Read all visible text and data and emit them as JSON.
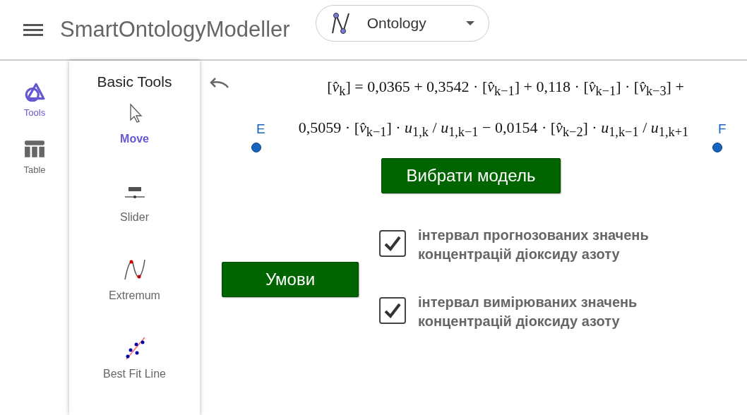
{
  "header": {
    "title": "SmartOntologyModeller",
    "app_selector": {
      "label": "Ontology"
    }
  },
  "rail": [
    {
      "kind": "tools",
      "label": "Tools",
      "selected": true
    },
    {
      "kind": "table",
      "label": "Table",
      "selected": false
    }
  ],
  "tool_panel": {
    "title": "Basic Tools",
    "tools": [
      {
        "kind": "move",
        "label": "Move",
        "selected": true
      },
      {
        "kind": "slider",
        "label": "Slider",
        "selected": false
      },
      {
        "kind": "extremum",
        "label": "Extremum",
        "selected": false
      },
      {
        "kind": "fitline",
        "label": "Best Fit Line",
        "selected": false
      }
    ]
  },
  "canvas": {
    "formula_lines": [
      "[*v̂*$_{k}$] = 0,0365 + 0,3542 · [*v̂*$_{k−1}$] + 0,118 · [*v̂*$_{k−1}$] · [*v̂*$_{k−3}$] +",
      "0,5059 · [*v̂*$_{k−1}$] · *u*$_{1,k}$ / *u*$_{1,k−1}$ − 0,0154 · [*v̂*$_{k−2}$] · *u*$_{1,k−1}$ / *u*$_{1,k+1}$"
    ],
    "points": [
      {
        "label": "E"
      },
      {
        "label": "F"
      }
    ],
    "buttons": [
      {
        "kind": "model",
        "label": "Вибрати модель"
      },
      {
        "kind": "conditions",
        "label": "Умови"
      }
    ],
    "checkboxes": [
      {
        "label": "інтервал прогнозованих значень концентрацій діоксиду азоту",
        "checked": true
      },
      {
        "label": "інтервал вимірюваних значень концентрацій діоксиду азоту",
        "checked": true
      }
    ]
  }
}
